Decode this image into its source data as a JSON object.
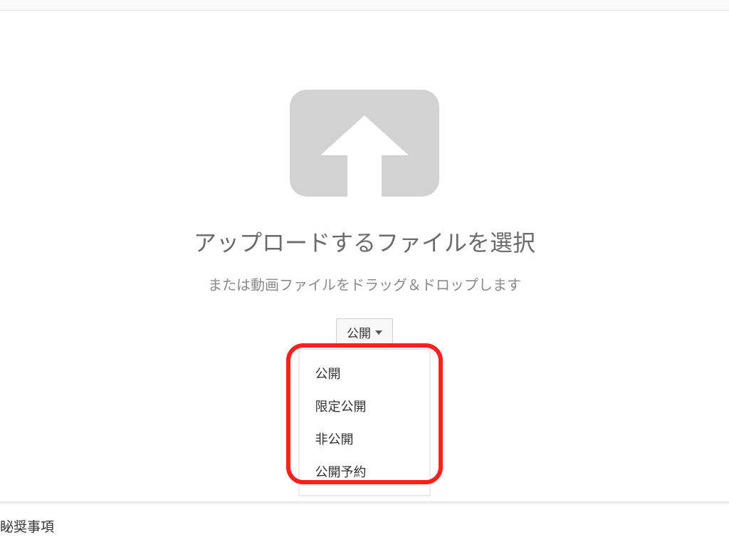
{
  "upload": {
    "title": "アップロードするファイルを選択",
    "subtitle": "または動画ファイルをドラッグ＆ドロップします"
  },
  "visibility": {
    "selected": "公開",
    "options": [
      "公開",
      "限定公開",
      "非公開",
      "公開予約"
    ]
  },
  "footer": {
    "partial": "䀣奨事項"
  }
}
